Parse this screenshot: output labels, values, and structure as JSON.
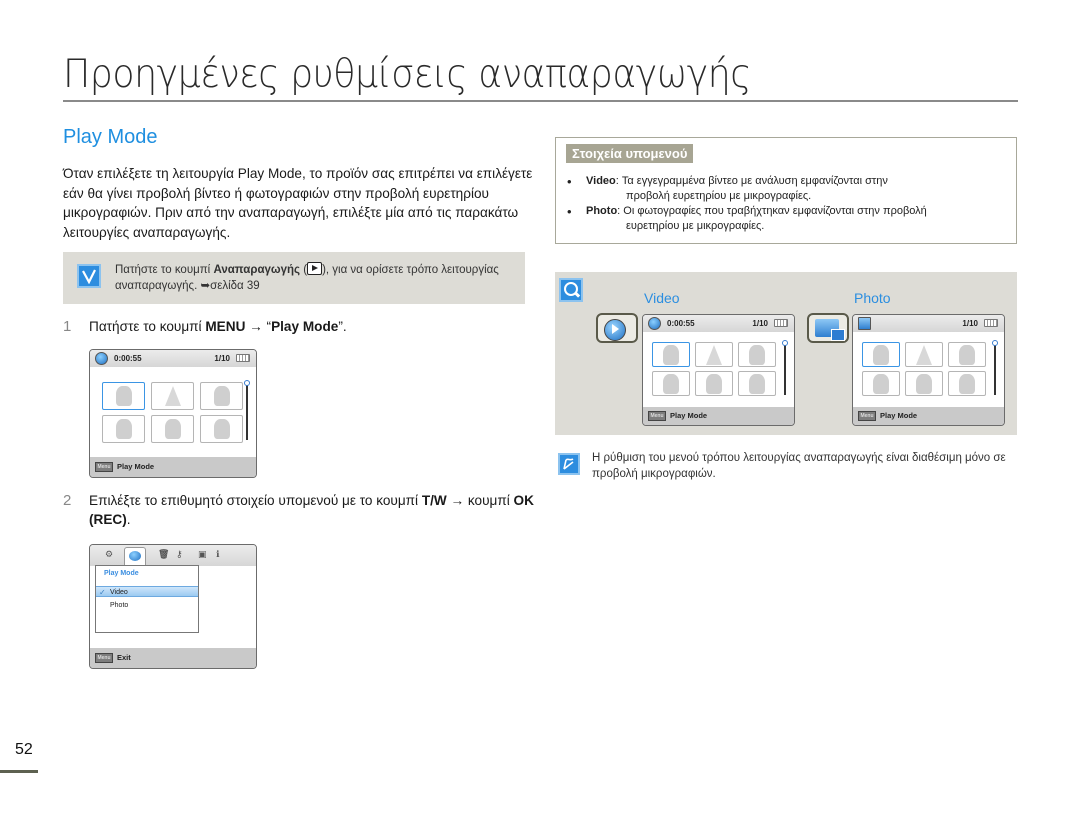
{
  "page": {
    "title": "Προηγμένες ρυθμίσεις αναπαραγωγής",
    "number": "52"
  },
  "section": {
    "title": "Play Mode",
    "intro": "Όταν επιλέξετε τη λειτουργία Play Mode, το προϊόν σας επιτρέπει να επιλέγετε εάν θα γίνει προβολή βίντεο ή φωτογραφιών στην προβολή ευρετηρίου μικρογραφιών. Πριν από την αναπαραγωγή, επιλέξτε μία από τις παρακάτω λειτουργίες αναπαραγωγής."
  },
  "note": {
    "icon": "checkbox-icon",
    "text_before": "Πατήστε το κουμπί ",
    "text_bold": "Αναπαραγωγής",
    "text_after_icon": "), για να ορίσετε τρόπο λειτουργίας αναπαραγωγής. ",
    "page_ref": "➥σελίδα 39"
  },
  "steps": [
    {
      "number": "1",
      "text_pre": "Πατήστε το κουμπί ",
      "bold_1": "MENU",
      "mid": " → “",
      "bold_2": "Play Mode",
      "post": "”."
    },
    {
      "number": "2",
      "text_pre": "Επιλέξτε το επιθυμητό στοιχείο υπομενού με το κουμπί ",
      "bold_1": "T/W",
      "mid": " → κουμπί ",
      "bold_2": "OK (REC)",
      "post": "."
    }
  ],
  "lcd_index": {
    "time": "0:00:55",
    "count": "1/10",
    "menu_key": "Menu",
    "bottom_label": "Play Mode",
    "thumbnails": [
      "golfer",
      "sailboat",
      "couple",
      "park",
      "soccer",
      "palm"
    ],
    "scroll_position": 0
  },
  "lcd_menu": {
    "tabs": [
      "settings-icon",
      "play-mode-icon",
      "delete-icon",
      "protect-icon",
      "copy-icon",
      "info-icon"
    ],
    "popup_title": "Play Mode",
    "options": [
      "Video",
      "Photo"
    ],
    "selected": "Video",
    "menu_key": "Menu",
    "bottom_label": "Exit"
  },
  "submenu": {
    "heading": "Στοιχεία υπομενού",
    "items": [
      {
        "label": "Video",
        "desc_1": ": Τα εγγεγραμμένα βίντεο με ανάλυση εμφανίζονται στην",
        "desc_2": "προβολή ευρετηρίου με μικρογραφίες."
      },
      {
        "label": "Photo",
        "desc_1": ": Οι φωτογραφίες που τραβήχτηκαν εμφανίζονται στην προβολή",
        "desc_2": "ευρετηρίου με μικρογραφίες."
      }
    ]
  },
  "preview": {
    "video": {
      "label": "Video",
      "time": "0:00:55",
      "count": "1/10",
      "menu_key": "Menu",
      "bottom_label": "Play Mode"
    },
    "photo": {
      "label": "Photo",
      "count": "1/10",
      "menu_key": "Menu",
      "bottom_label": "Play Mode"
    }
  },
  "tip": {
    "text": "Η ρύθμιση του μενού τρόπου λειτουργίας αναπαραγωγής είναι διαθέσιμη μόνο σε προβολή μικρογραφιών."
  },
  "colors": {
    "accent_blue": "#1f8fe0",
    "panel_gray": "#dddcd6",
    "heading_badge": "#a7a593"
  }
}
